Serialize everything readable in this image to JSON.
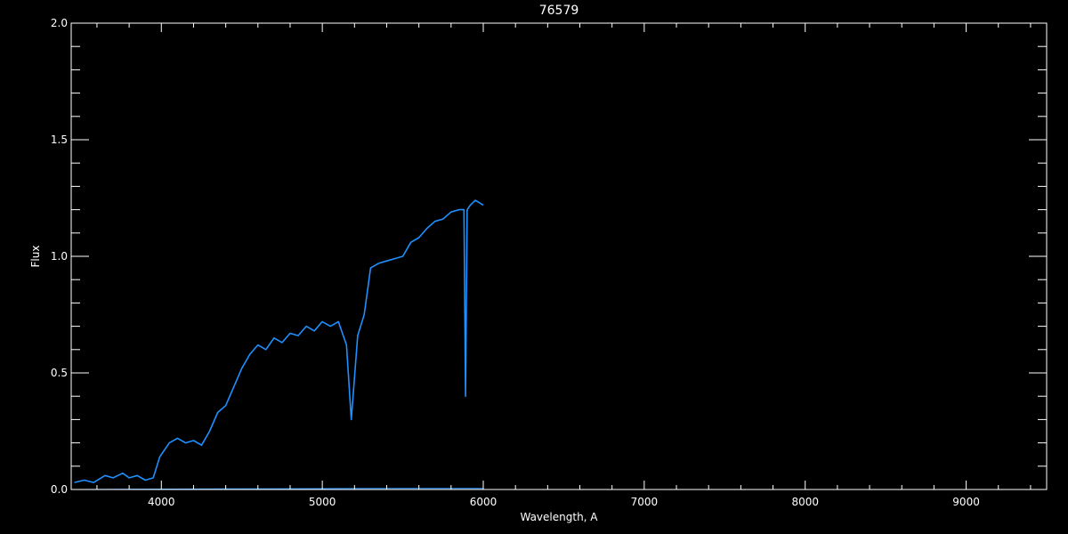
{
  "chart_data": {
    "type": "line",
    "title": "76579",
    "xlabel": "Wavelength, A",
    "ylabel": "Flux",
    "xlim": [
      3440,
      9500
    ],
    "ylim": [
      0.0,
      2.0
    ],
    "x_ticks": [
      4000,
      5000,
      6000,
      7000,
      8000,
      9000
    ],
    "x_tick_labels": [
      "4000",
      "5000",
      "6000",
      "7000",
      "8000",
      "9000"
    ],
    "y_ticks": [
      0.0,
      0.5,
      1.0,
      1.5,
      2.0
    ],
    "y_tick_labels": [
      "0.0",
      "0.5",
      "1.0",
      "1.5",
      "2.0"
    ],
    "grid": false,
    "colors": {
      "background": "#000000",
      "axes": "#ffffff",
      "flux": "#1e90ff",
      "error": "#1e90ff"
    },
    "series": [
      {
        "x": [
          3460,
          3520,
          3580,
          3650,
          3700,
          3760,
          3800,
          3850,
          3900,
          3950,
          3990,
          4050,
          4100,
          4150,
          4200,
          4250,
          4300,
          4350,
          4400,
          4450,
          4500,
          4550,
          4600,
          4650,
          4700,
          4750,
          4800,
          4850,
          4900,
          4950,
          5000,
          5050,
          5100,
          5150,
          5180,
          5220,
          5260,
          5300,
          5350,
          5400,
          5450,
          5500,
          5550,
          5600,
          5650,
          5700,
          5750,
          5800,
          5850,
          5880,
          5890,
          5900,
          5920,
          5950,
          6000
        ],
        "y": [
          0.03,
          0.04,
          0.03,
          0.06,
          0.05,
          0.07,
          0.05,
          0.06,
          0.04,
          0.05,
          0.14,
          0.2,
          0.22,
          0.2,
          0.21,
          0.19,
          0.25,
          0.33,
          0.36,
          0.44,
          0.52,
          0.58,
          0.62,
          0.6,
          0.65,
          0.63,
          0.67,
          0.66,
          0.7,
          0.68,
          0.72,
          0.7,
          0.72,
          0.62,
          0.3,
          0.66,
          0.75,
          0.95,
          0.97,
          0.98,
          0.99,
          1.0,
          1.06,
          1.08,
          1.12,
          1.15,
          1.16,
          1.19,
          1.2,
          1.2,
          0.4,
          1.2,
          1.22,
          1.24,
          1.22
        ]
      },
      {
        "x": [
          3460,
          4000,
          4500,
          5000,
          5500,
          6000
        ],
        "y": [
          0.0,
          0.002,
          0.003,
          0.004,
          0.005,
          0.005
        ]
      }
    ]
  }
}
